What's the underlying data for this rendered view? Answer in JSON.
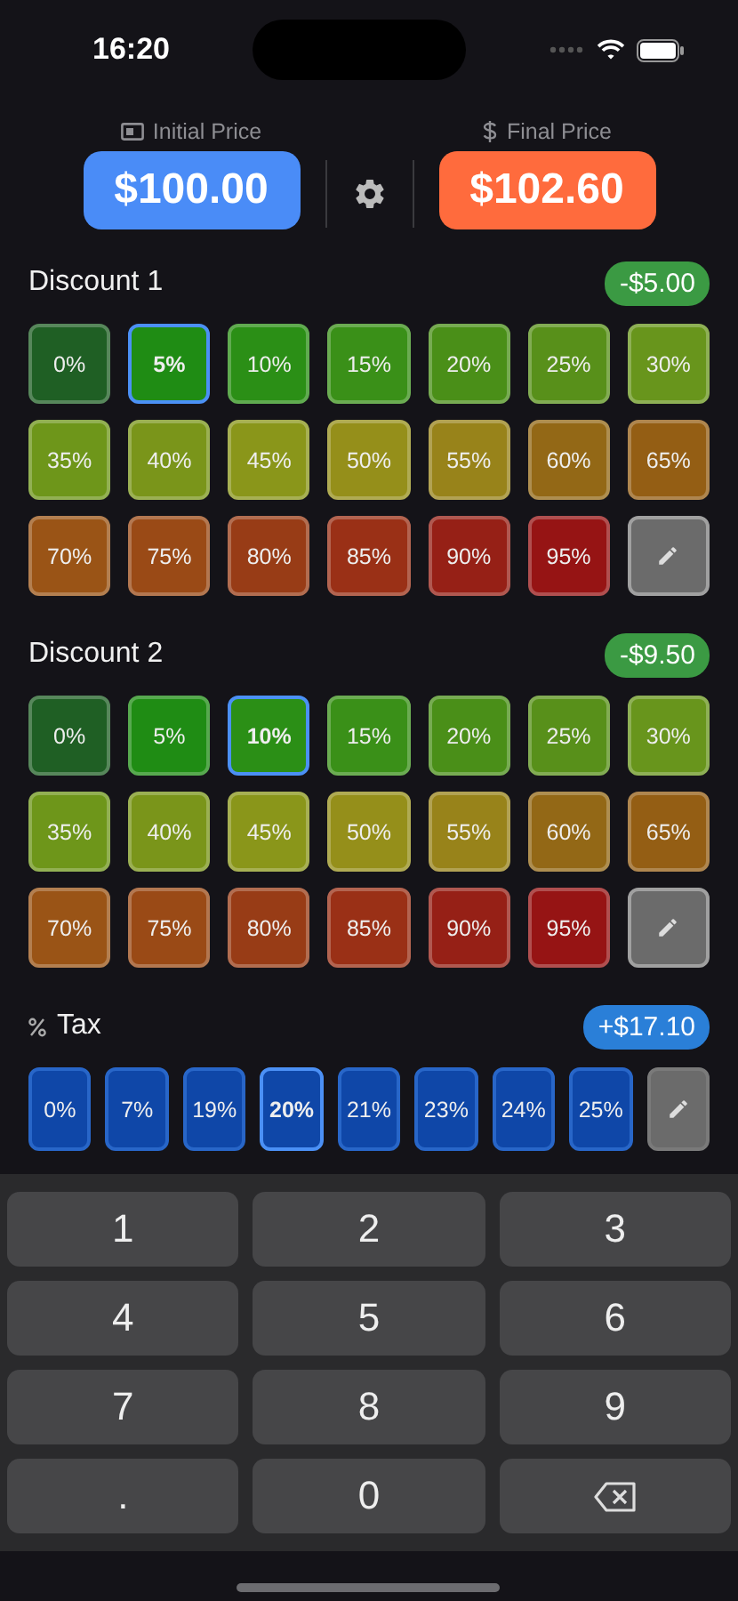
{
  "status_bar": {
    "time": "16:20"
  },
  "header": {
    "initial": {
      "label": "Initial Price",
      "value": "$100.00"
    },
    "final": {
      "label": "Final Price",
      "value": "$102.60"
    }
  },
  "discounts": [
    {
      "title": "Discount 1",
      "amount": "-$5.00",
      "options": [
        {
          "label": "0%",
          "color": "#1f5f24",
          "selected": false
        },
        {
          "label": "5%",
          "color": "#1f8c14",
          "selected": true
        },
        {
          "label": "10%",
          "color": "#2b8f16",
          "selected": false
        },
        {
          "label": "15%",
          "color": "#3a9018",
          "selected": false
        },
        {
          "label": "20%",
          "color": "#4a8f18",
          "selected": false
        },
        {
          "label": "25%",
          "color": "#58901a",
          "selected": false
        },
        {
          "label": "30%",
          "color": "#68951c",
          "selected": false
        },
        {
          "label": "35%",
          "color": "#6e961a",
          "selected": false
        },
        {
          "label": "40%",
          "color": "#7a951a",
          "selected": false
        },
        {
          "label": "45%",
          "color": "#8a961a",
          "selected": false
        },
        {
          "label": "50%",
          "color": "#958f1a",
          "selected": false
        },
        {
          "label": "55%",
          "color": "#98831a",
          "selected": false
        },
        {
          "label": "60%",
          "color": "#936816",
          "selected": false
        },
        {
          "label": "65%",
          "color": "#945e14",
          "selected": false
        },
        {
          "label": "70%",
          "color": "#9a5416",
          "selected": false
        },
        {
          "label": "75%",
          "color": "#9a4a16",
          "selected": false
        },
        {
          "label": "80%",
          "color": "#983c16",
          "selected": false
        },
        {
          "label": "85%",
          "color": "#9a3016",
          "selected": false
        },
        {
          "label": "90%",
          "color": "#962016",
          "selected": false
        },
        {
          "label": "95%",
          "color": "#961414",
          "selected": false
        }
      ]
    },
    {
      "title": "Discount 2",
      "amount": "-$9.50",
      "options": [
        {
          "label": "0%",
          "color": "#1f5f24",
          "selected": false
        },
        {
          "label": "5%",
          "color": "#1f8c14",
          "selected": false
        },
        {
          "label": "10%",
          "color": "#2b8f16",
          "selected": true
        },
        {
          "label": "15%",
          "color": "#3a9018",
          "selected": false
        },
        {
          "label": "20%",
          "color": "#4a8f18",
          "selected": false
        },
        {
          "label": "25%",
          "color": "#58901a",
          "selected": false
        },
        {
          "label": "30%",
          "color": "#68951c",
          "selected": false
        },
        {
          "label": "35%",
          "color": "#6e961a",
          "selected": false
        },
        {
          "label": "40%",
          "color": "#7a951a",
          "selected": false
        },
        {
          "label": "45%",
          "color": "#8a961a",
          "selected": false
        },
        {
          "label": "50%",
          "color": "#958f1a",
          "selected": false
        },
        {
          "label": "55%",
          "color": "#98831a",
          "selected": false
        },
        {
          "label": "60%",
          "color": "#936816",
          "selected": false
        },
        {
          "label": "65%",
          "color": "#945e14",
          "selected": false
        },
        {
          "label": "70%",
          "color": "#9a5416",
          "selected": false
        },
        {
          "label": "75%",
          "color": "#9a4a16",
          "selected": false
        },
        {
          "label": "80%",
          "color": "#983c16",
          "selected": false
        },
        {
          "label": "85%",
          "color": "#9a3016",
          "selected": false
        },
        {
          "label": "90%",
          "color": "#962016",
          "selected": false
        },
        {
          "label": "95%",
          "color": "#961414",
          "selected": false
        }
      ]
    }
  ],
  "tax": {
    "title": "Tax",
    "amount": "+$17.10",
    "options": [
      {
        "label": "0%",
        "selected": false
      },
      {
        "label": "7%",
        "selected": false
      },
      {
        "label": "19%",
        "selected": false
      },
      {
        "label": "20%",
        "selected": true
      },
      {
        "label": "21%",
        "selected": false
      },
      {
        "label": "23%",
        "selected": false
      },
      {
        "label": "24%",
        "selected": false
      },
      {
        "label": "25%",
        "selected": false
      }
    ]
  },
  "keypad": [
    {
      "kind": "text",
      "label": "1"
    },
    {
      "kind": "text",
      "label": "2"
    },
    {
      "kind": "text",
      "label": "3"
    },
    {
      "kind": "text",
      "label": "4"
    },
    {
      "kind": "text",
      "label": "5"
    },
    {
      "kind": "text",
      "label": "6"
    },
    {
      "kind": "text",
      "label": "7"
    },
    {
      "kind": "text",
      "label": "8"
    },
    {
      "kind": "text",
      "label": "9"
    },
    {
      "kind": "text",
      "label": "."
    },
    {
      "kind": "text",
      "label": "0"
    },
    {
      "kind": "backspace"
    }
  ]
}
